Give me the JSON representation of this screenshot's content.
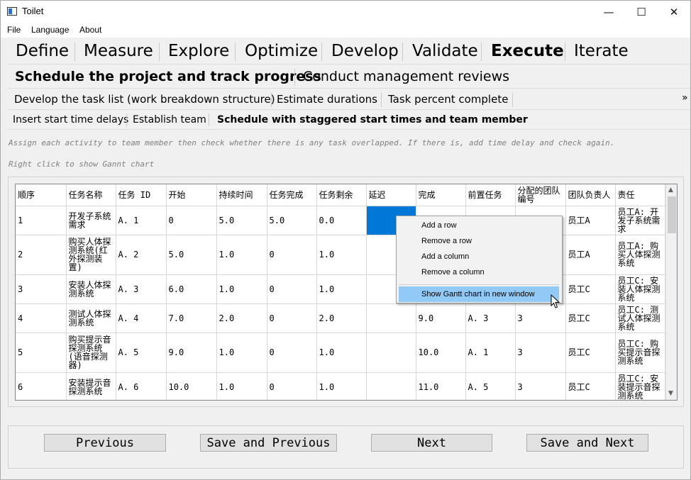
{
  "window": {
    "title": "Toilet",
    "minimize": "—",
    "maximize": "☐",
    "close": "✕"
  },
  "menu": [
    "File",
    "Language",
    "About"
  ],
  "phase_tabs": [
    "Define",
    "Measure",
    "Explore",
    "Optimize",
    "Develop",
    "Validate",
    "Execute",
    "Iterate"
  ],
  "active_phase": "Execute",
  "section_tabs": [
    "Schedule the project and track progress",
    "Conduct management reviews"
  ],
  "task_tabs": [
    "Develop the task list (work breakdown structure)",
    "Estimate durations",
    "Task percent complete"
  ],
  "task_tabs_overflow": "»",
  "step_tabs": [
    "Insert start time delays",
    "Establish team",
    "Schedule with staggered start times and team member"
  ],
  "hints": [
    "Assign each activity to team member then check whether there is any task overlapped. If there is, add time delay and check again.",
    "Right click to show Gannt chart"
  ],
  "table": {
    "headers": [
      "顺序",
      "任务名称",
      "任务 ID",
      "开始",
      "持续时间",
      "任务完成",
      "任务剩余",
      "延迟",
      "完成",
      "前置任务",
      "分配的团队编号",
      "团队负责人",
      "责任"
    ],
    "rows": [
      [
        "1",
        "开发子系统需求",
        "A. 1",
        "0",
        "5.0",
        "5.0",
        "0.0",
        "",
        "",
        "",
        "",
        "员工A",
        "员工A: 开发子系统需求"
      ],
      [
        "2",
        "购买人体探测系统(红外探测装置)",
        "A. 2",
        "5.0",
        "1.0",
        "0",
        "1.0",
        "",
        "",
        "",
        "",
        "员工A",
        "员工A: 购买人体探测系统"
      ],
      [
        "3",
        "安装人体探测系统",
        "A. 3",
        "6.0",
        "1.0",
        "0",
        "1.0",
        "",
        "",
        "",
        "",
        "员工C",
        "员工C: 安装人体探测系统"
      ],
      [
        "4",
        "测试人体探测系统",
        "A. 4",
        "7.0",
        "2.0",
        "0",
        "2.0",
        "",
        "9.0",
        "A. 3",
        "3",
        "员工C",
        "员工C: 测试人体探测系统"
      ],
      [
        "5",
        "购买提示音探测系统(语音探测器)",
        "A. 5",
        "9.0",
        "1.0",
        "0",
        "1.0",
        "",
        "10.0",
        "A. 1",
        "3",
        "员工C",
        "员工C: 购买提示音探测系统"
      ],
      [
        "6",
        "安装提示音探测系统",
        "A. 6",
        "10.0",
        "1.0",
        "0",
        "1.0",
        "",
        "11.0",
        "A. 5",
        "3",
        "员工C",
        "员工C: 安装提示音探测系统"
      ]
    ]
  },
  "context_menu": {
    "items": [
      "Add a row",
      "Remove a row",
      "Add a column",
      "Remove a column",
      "Show Gantt chart in new window"
    ],
    "highlighted": "Show Gantt chart in new window"
  },
  "buttons": {
    "previous": "Previous",
    "save_previous": "Save and Previous",
    "next": "Next",
    "save_next": "Save and Next"
  },
  "colors": {
    "selection": "#0078d7",
    "menu_highlight": "#91c9f7"
  }
}
